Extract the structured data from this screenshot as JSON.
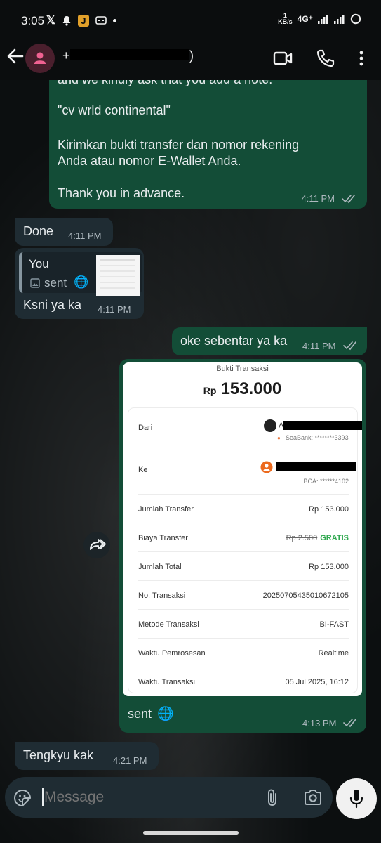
{
  "status_bar": {
    "time": "3:05",
    "speed_value": "1",
    "speed_unit": "KB/s",
    "network": "4G⁺"
  },
  "header": {
    "contact_name": "+",
    "contact_suffix": ")",
    "avatar_color": "#f06292"
  },
  "messages": [
    {
      "id": "msg1",
      "dir": "out",
      "lines": [
        "and we kindly ask that you add a note:",
        "\"cv wrld continental\"",
        "Kirimkan bukti transfer dan nomor rekening",
        "Anda atau nomor E-Wallet Anda.",
        "Thank you in advance."
      ],
      "time": "4:11 PM",
      "read": true
    },
    {
      "id": "msg2",
      "dir": "in",
      "text": "Done",
      "time": "4:11 PM"
    },
    {
      "id": "msg3",
      "dir": "in",
      "quote_author": "You",
      "quote_text": "sent",
      "text": "Ksni ya ka",
      "time": "4:11 PM"
    },
    {
      "id": "msg4",
      "dir": "out",
      "text": "oke sebentar ya ka",
      "time": "4:11 PM",
      "read": true
    },
    {
      "id": "msg5",
      "dir": "out",
      "caption": "sent",
      "time": "4:13 PM",
      "read": true
    },
    {
      "id": "msg6",
      "dir": "in",
      "text": "Tengkyu kak",
      "time": "4:21 PM"
    }
  ],
  "receipt": {
    "title": "Bukti Transaksi",
    "currency": "Rp",
    "amount": "153.000",
    "from_label": "Dari",
    "from_initial": "A",
    "from_bank": "SeaBank: ********3393",
    "to_label": "Ke",
    "to_bank": "BCA: ******4102",
    "rows": [
      {
        "label": "Jumlah Transfer",
        "value": "Rp 153.000"
      },
      {
        "label": "Biaya Transfer",
        "value_strike": "Rp 2.500",
        "value": "GRATIS"
      },
      {
        "label": "Jumlah Total",
        "value": "Rp 153.000"
      },
      {
        "label": "No. Transaksi",
        "value": "20250705435010672105"
      },
      {
        "label": "Metode Transaksi",
        "value": "BI-FAST"
      },
      {
        "label": "Waktu Pemrosesan",
        "value": "Realtime"
      },
      {
        "label": "Waktu Transaksi",
        "value": "05 Jul 2025, 16:12"
      }
    ]
  },
  "input": {
    "placeholder": "Message"
  },
  "colors": {
    "outgoing_bubble": "#134d37",
    "incoming_bubble": "#1f2c33",
    "read_ticks": "#aeb9bf",
    "gratis": "#2fa84f"
  }
}
